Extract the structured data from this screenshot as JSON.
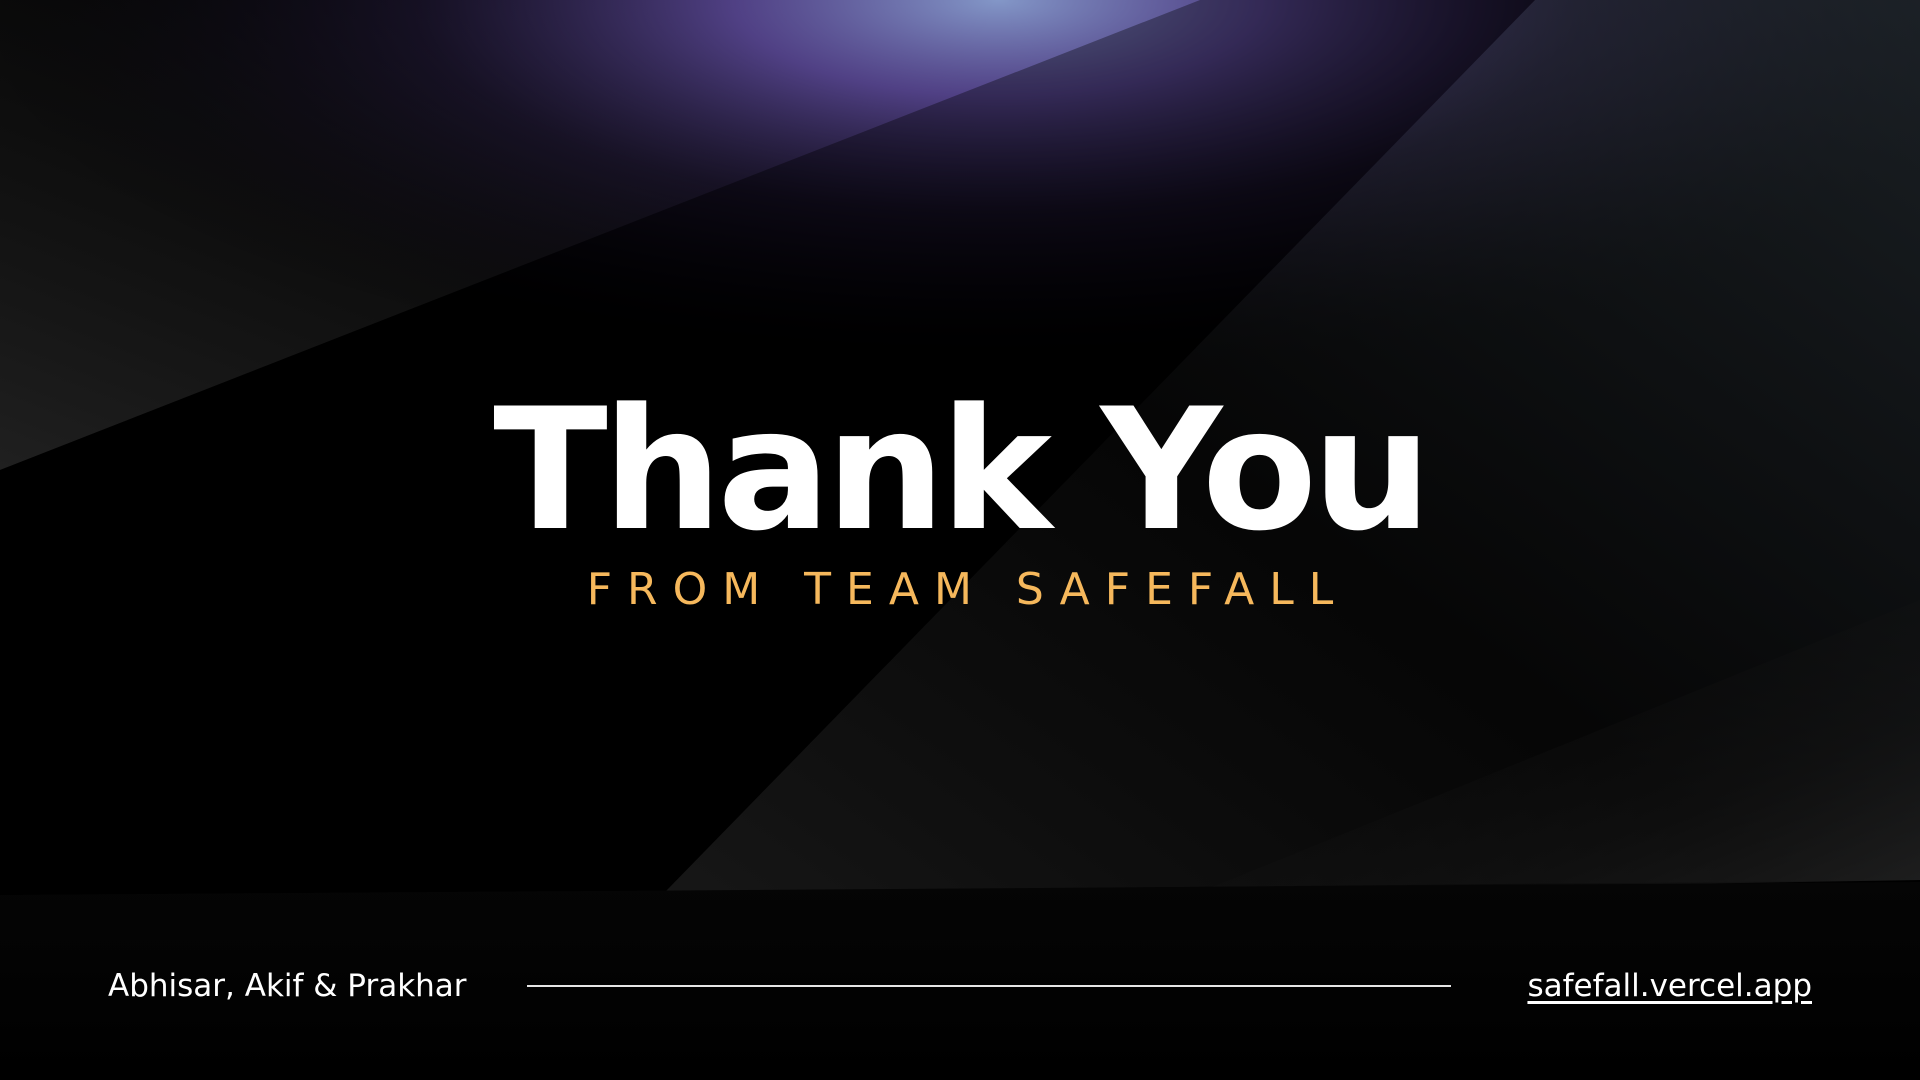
{
  "slide": {
    "title": "Thank You",
    "subtitle": "FROM TEAM SAFEFALL",
    "footer": {
      "names": "Abhisar, Akif & Prakhar",
      "link": "safefall.vercel.app"
    }
  },
  "colors": {
    "background": "#000000",
    "title": "#ffffff",
    "subtitle": "#f6b85c",
    "footer_text": "#ffffff",
    "glow_purple": "#6a4fb0",
    "glow_blue": "#7f96c8"
  }
}
